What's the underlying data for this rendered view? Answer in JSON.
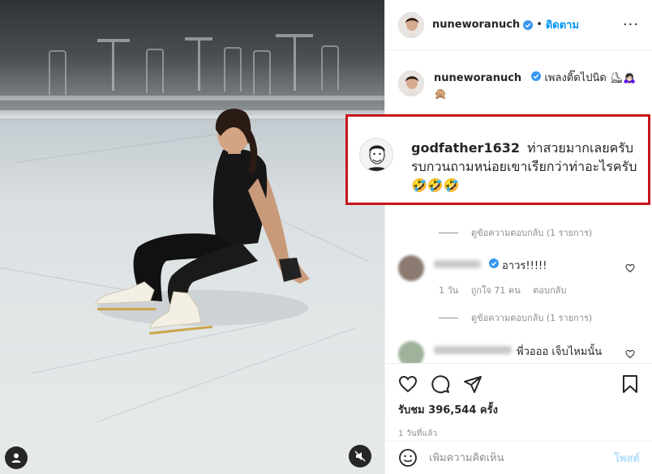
{
  "post": {
    "username": "nuneworanuch",
    "follow_label": "ติดตาม",
    "separator": "•",
    "more_label": "···",
    "caption": "เพลงติ๊ดไปนิด ⛸🙇🏻‍♀️🙊"
  },
  "highlighted_comment": {
    "username": "godfather1632",
    "text": "ท่าสวยมากเลยครับ รบกวนถามหน่อยเขาเรียกว่าท่าอะไรครับ 🤣🤣🤣"
  },
  "comments": [
    {
      "view_replies": "ดูข้อความตอบกลับ (1 รายการ)"
    },
    {
      "text": "อาวร!!!!!",
      "age": "1 วัน",
      "likes": "ถูกใจ 71 คน",
      "reply": "ตอบกลับ",
      "view_replies": "ดูข้อความตอบกลับ (1 รายการ)"
    },
    {
      "text": "พี่วอออ เจ็บไหมนั้น"
    }
  ],
  "stats": {
    "views": "รับชม 396,544 ครั้ง",
    "time_ago": "1 วันที่แล้ว"
  },
  "composer": {
    "placeholder": "เพิ่มความคิดเห็น",
    "post_label": "โพสต์"
  },
  "icons": {
    "verified": "verified-badge-icon",
    "like": "heart-icon",
    "comment": "comment-bubble-icon",
    "share": "paper-plane-icon",
    "save": "bookmark-icon",
    "emoji": "smiley-icon",
    "mute": "muted-speaker-icon",
    "tagged": "user-tag-icon"
  },
  "colors": {
    "link_blue": "#0095f6",
    "verified_blue": "#3897f0",
    "highlight_red": "#c8151b",
    "post_disabled": "#b2dffc"
  }
}
